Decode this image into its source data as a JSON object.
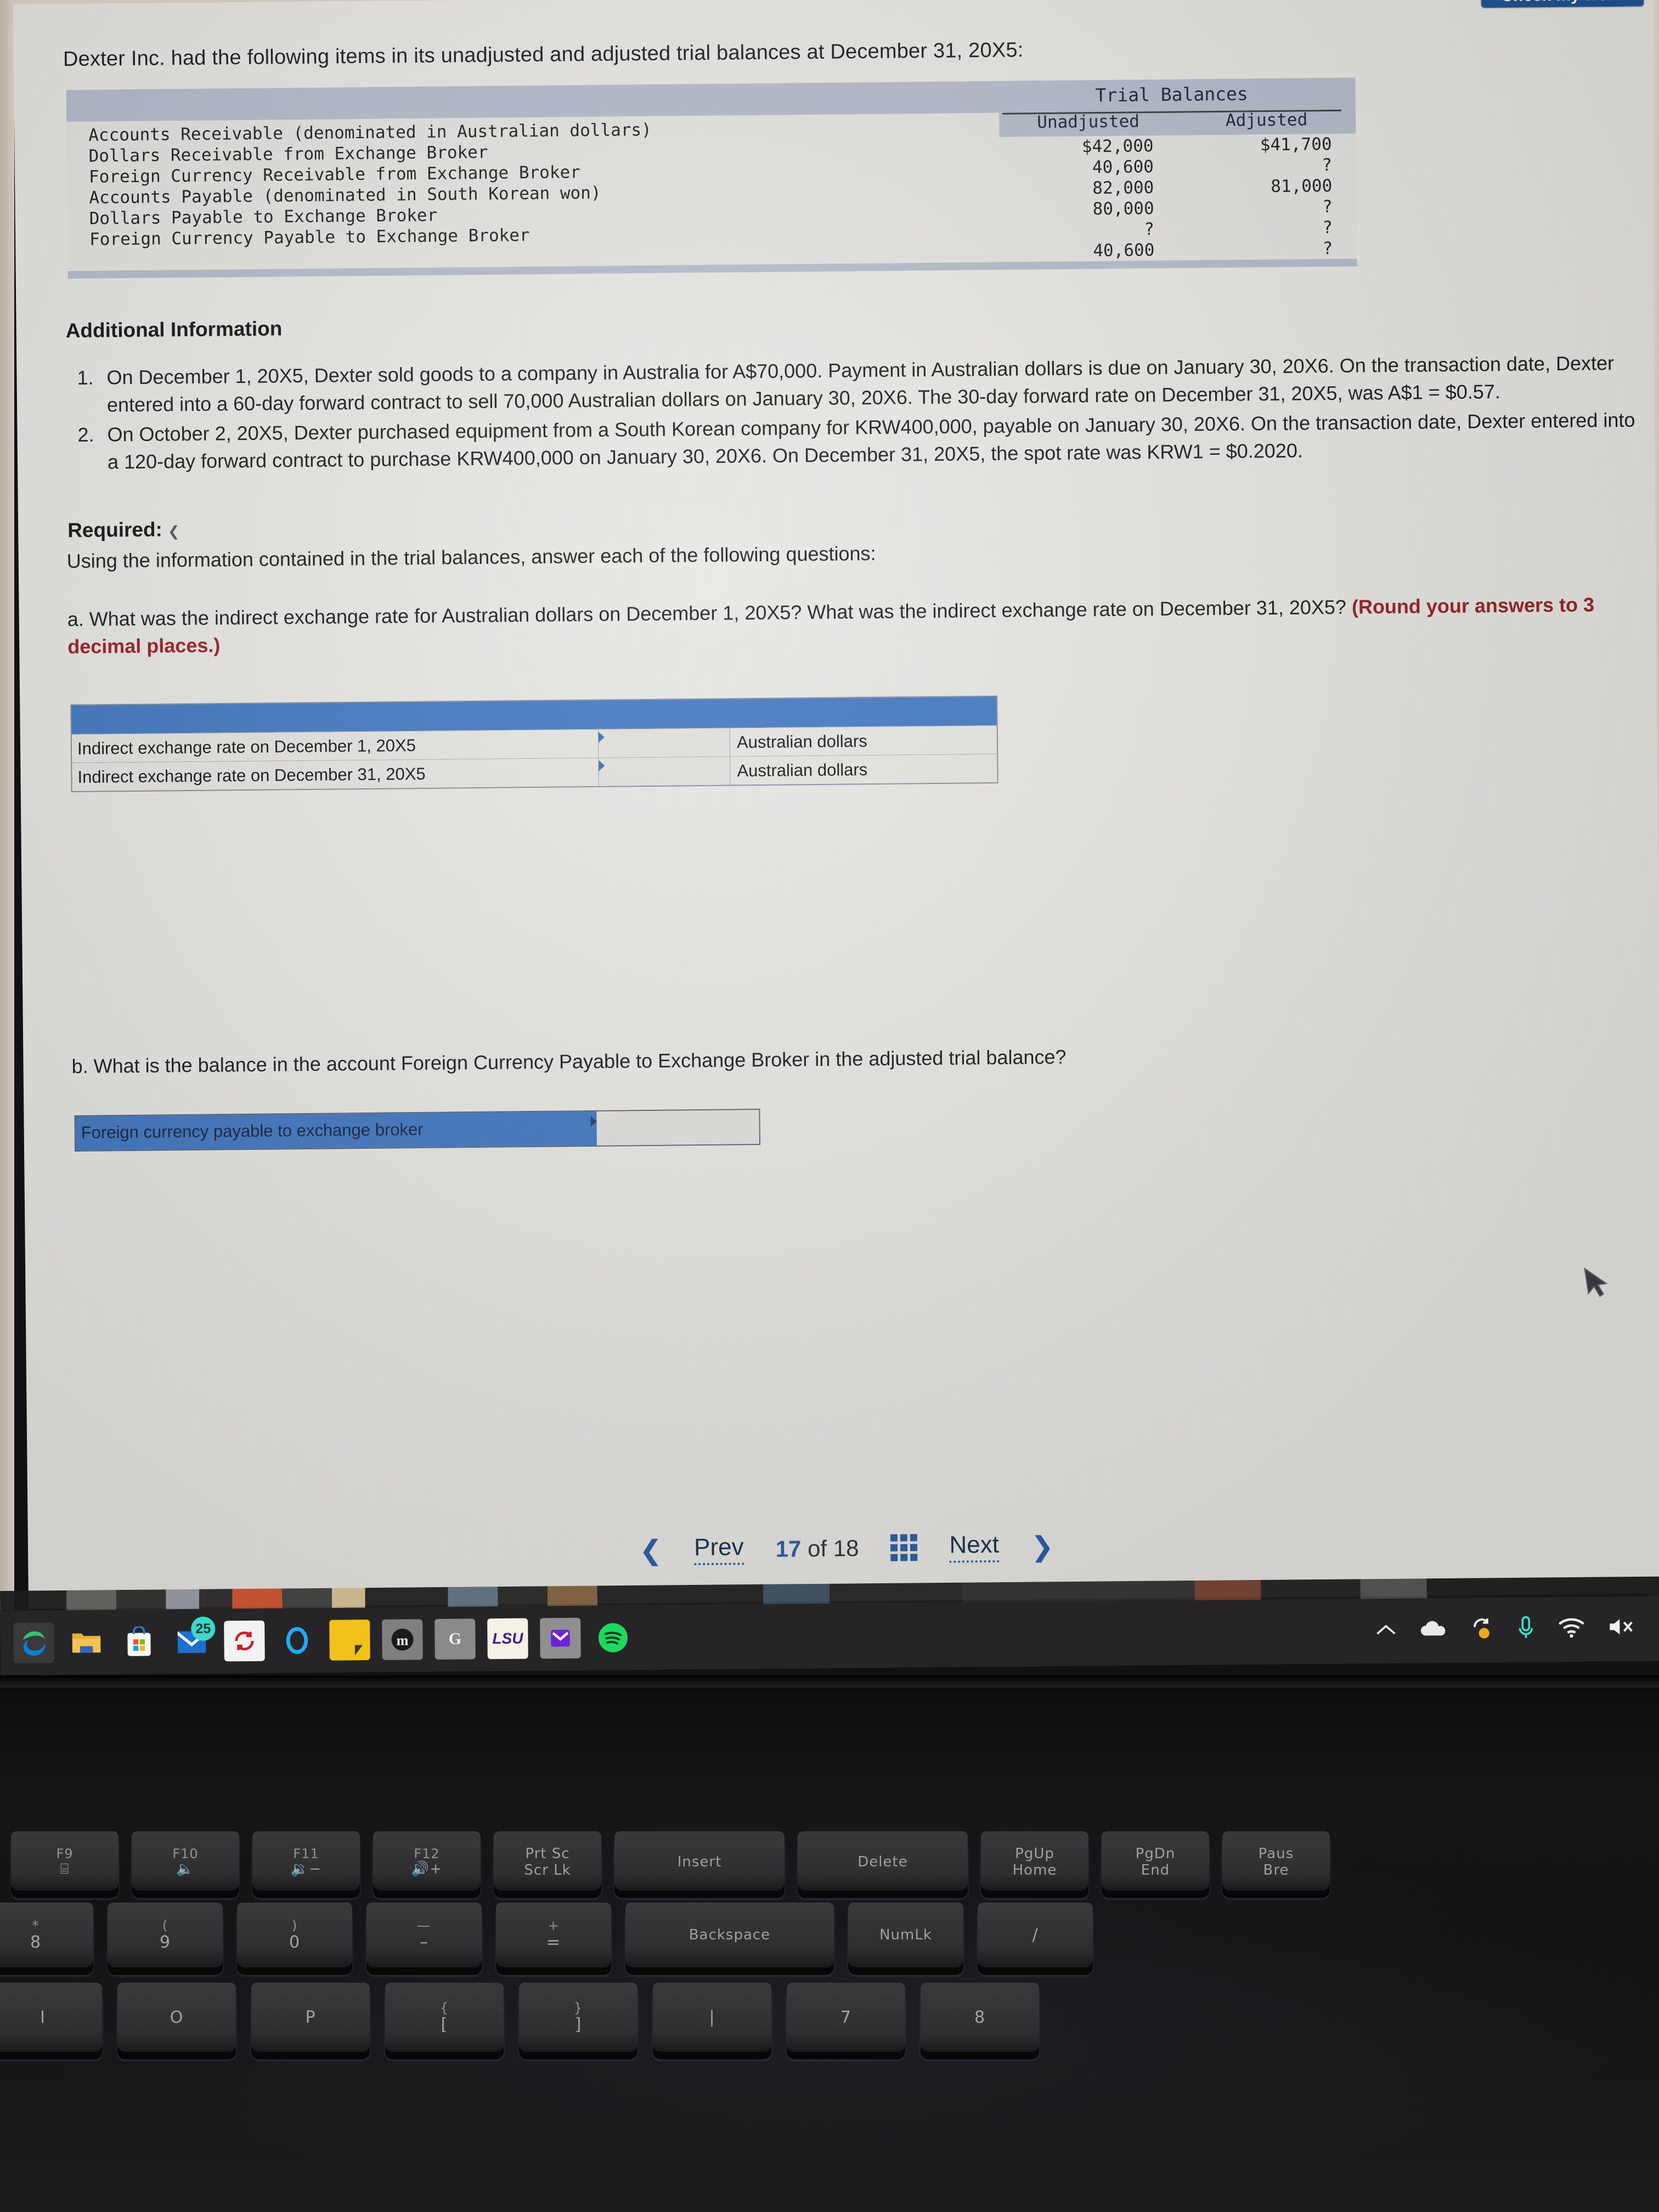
{
  "checkwork": {
    "label": "Check my work"
  },
  "document": {
    "intro": "Dexter Inc. had the following items in its unadjusted and adjusted trial balances at December 31, 20X5:",
    "trial_balances": {
      "group_header": "Trial Balances",
      "columns": [
        "Unadjusted",
        "Adjusted"
      ],
      "rows": [
        {
          "account": "Accounts Receivable (denominated in Australian dollars)",
          "unadjusted": "$42,000",
          "adjusted": "$41,700"
        },
        {
          "account": "Dollars Receivable from Exchange Broker",
          "unadjusted": "40,600",
          "adjusted": "?"
        },
        {
          "account": "Foreign Currency Receivable from Exchange Broker",
          "unadjusted": "82,000",
          "adjusted": "81,000"
        },
        {
          "account": "Accounts Payable (denominated in South Korean won)",
          "unadjusted": "80,000",
          "adjusted": "?"
        },
        {
          "account": "Dollars Payable to Exchange Broker",
          "unadjusted": "?",
          "adjusted": "?"
        },
        {
          "account": "Foreign Currency Payable to Exchange Broker",
          "unadjusted": "40,600",
          "adjusted": "?"
        }
      ]
    },
    "additional_information": {
      "heading": "Additional Information",
      "items": [
        "On December 1, 20X5, Dexter sold goods to a company in Australia for A$70,000. Payment in Australian dollars is due on January 30, 20X6. On the transaction date, Dexter entered into a 60-day forward contract to sell 70,000 Australian dollars on January 30, 20X6. The 30-day forward rate on December 31, 20X5, was A$1 = $0.57.",
        "On October 2, 20X5, Dexter purchased equipment from a South Korean company for KRW400,000, payable on January 30, 20X6. On the transaction date, Dexter entered into a 120-day forward contract to purchase KRW400,000 on January 30, 20X6. On December 31, 20X5, the spot rate was KRW1 = $0.2020."
      ]
    },
    "required": {
      "heading": "Required:",
      "subtext": "Using the information contained in the trial balances, answer each of the following questions:"
    },
    "question_a": {
      "text": "a. What was the indirect exchange rate for Australian dollars on December 1, 20X5? What was the indirect exchange rate on December 31, 20X5? ",
      "rounding_note": "(Round your answers to 3 decimal places.)",
      "table": {
        "rows": [
          {
            "label": "Indirect exchange rate on December 1, 20X5",
            "value": "",
            "unit": "Australian dollars"
          },
          {
            "label": "Indirect exchange rate on December 31, 20X5",
            "value": "",
            "unit": "Australian dollars"
          }
        ]
      }
    },
    "question_b": {
      "text": "b. What is the balance in the account Foreign Currency Payable to Exchange Broker in the adjusted trial balance?",
      "table": {
        "rows": [
          {
            "label": "Foreign currency payable to exchange broker",
            "value": ""
          }
        ]
      }
    }
  },
  "navigation": {
    "prev_label": "Prev",
    "next_label": "Next",
    "current_page": "17",
    "of_word": "of",
    "total_pages": "18",
    "grid_icon": "grid-icon"
  },
  "taskbar": {
    "icons": [
      {
        "name": "edge-icon",
        "glyph": "e",
        "color": "#1aa3e8",
        "bg": "",
        "active": true
      },
      {
        "name": "file-explorer-icon",
        "glyph": "▃",
        "color": "#e8b33a",
        "bg": ""
      },
      {
        "name": "microsoft-store-icon",
        "glyph": "⊞",
        "color": "#f0f0f0",
        "bg": ""
      },
      {
        "name": "mail-icon",
        "glyph": "✉",
        "color": "#1f6fd0",
        "bg": "",
        "badge": "25"
      },
      {
        "name": "sync-icon",
        "glyph": "↻",
        "color": "#c22033",
        "bg": "#f2f2f2"
      },
      {
        "name": "cortana-icon",
        "glyph": "◯",
        "color": "#23a9f2",
        "bg": ""
      },
      {
        "name": "sticky-notes-icon",
        "glyph": "◢",
        "color": "#3a3a3a",
        "bg": "#f2c11a"
      },
      {
        "name": "moodle-icon",
        "glyph": "m",
        "color": "#f5f5f5",
        "bg": "#7f7f7f"
      },
      {
        "name": "google-icon",
        "glyph": "G",
        "color": "#f0f0f0",
        "bg": "#8a8a8a"
      },
      {
        "name": "lsu-icon",
        "glyph": "LSU",
        "color": "#461d7c",
        "bg": "#f5f2e8"
      },
      {
        "name": "yahoo-mail-icon",
        "glyph": "▼",
        "color": "#6f21d6",
        "bg": "#8f8f8f"
      },
      {
        "name": "spotify-icon",
        "glyph": "♫",
        "color": "#1ed760",
        "bg": ""
      }
    ],
    "tray": [
      {
        "name": "show-hidden-icons-chevron",
        "glyph": "⌃"
      },
      {
        "name": "onedrive-cloud-icon",
        "glyph": "☁"
      },
      {
        "name": "sync-pending-icon",
        "glyph": "↺"
      },
      {
        "name": "microphone-icon",
        "glyph": "☢"
      },
      {
        "name": "wifi-icon",
        "glyph": "◠"
      },
      {
        "name": "volume-muted-icon",
        "glyph": "🔇"
      }
    ]
  },
  "keyboard": {
    "function_row": [
      {
        "top": "F9",
        "sub": "⌸"
      },
      {
        "top": "F10",
        "sub": "🔈"
      },
      {
        "top": "F11",
        "sub": "🔉−"
      },
      {
        "top": "F12",
        "sub": "🔊+"
      },
      {
        "top": "Prt Sc",
        "sub": "Scr Lk"
      },
      {
        "top": "Insert",
        "sub": ""
      },
      {
        "top": "Delete",
        "sub": ""
      },
      {
        "top": "PgUp",
        "sub": "Home"
      },
      {
        "top": "PgDn",
        "sub": "End"
      },
      {
        "top": "Paus",
        "sub": "Bre"
      }
    ],
    "number_row": [
      {
        "top": "*",
        "sub": "8"
      },
      {
        "top": "(",
        "sub": "9"
      },
      {
        "top": ")",
        "sub": "0"
      },
      {
        "top": "—",
        "sub": "–"
      },
      {
        "top": "+",
        "sub": "="
      },
      {
        "top": "Backspace",
        "sub": ""
      },
      {
        "top": "NumLk",
        "sub": ""
      },
      {
        "top": "/",
        "sub": ""
      }
    ],
    "letter_row": [
      {
        "top": "",
        "sub": "I"
      },
      {
        "top": "",
        "sub": "O"
      },
      {
        "top": "",
        "sub": "P"
      },
      {
        "top": "{",
        "sub": "["
      },
      {
        "top": "}",
        "sub": "]"
      },
      {
        "top": "",
        "sub": "|"
      },
      {
        "top": "",
        "sub": "7"
      },
      {
        "top": "",
        "sub": "8"
      }
    ]
  }
}
